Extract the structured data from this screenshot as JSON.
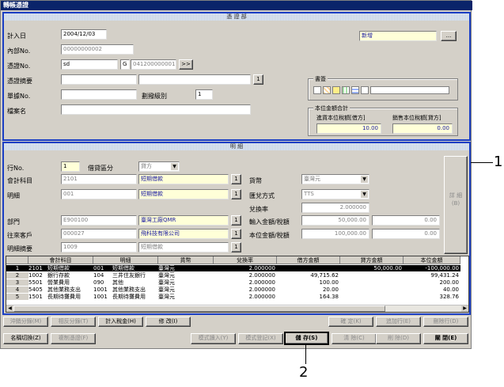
{
  "window": {
    "title": "轉帳憑證"
  },
  "header_panel": {
    "title": "憑 證 部",
    "entry_date_label": "計入日",
    "entry_date": "2004/12/03",
    "internal_no_label": "內部No.",
    "internal_no": "00000000002",
    "voucher_no_label": "憑證No.",
    "voucher_no": "sd",
    "voucher_type": "G",
    "voucher_seq": "041200000001",
    "voucher_btn": ">>",
    "summary_label": "憑證摘要",
    "summary_btn": "1",
    "doc_no_label": "單據No.",
    "revise_level_label": "劃撥級別",
    "revise_level": "1",
    "filename_label": "檔案名",
    "status": "新增",
    "status_btn": "...",
    "book_label": "書簽",
    "totals_label": "本位金額合計",
    "debit_total_label": "進貨本位稅額[借方]",
    "debit_total": "10.00",
    "credit_total_label": "銷售本位稅額[貸方]",
    "credit_total": "0.00"
  },
  "detail_panel": {
    "title": "明 細",
    "line_no_label": "行No.",
    "line_no": "1",
    "dc_label": "借貸區分",
    "dc_value": "貸方",
    "account_label": "會計科目",
    "account_code": "2101",
    "account_name": "短期借款",
    "detail_label": "明細",
    "detail_code": "001",
    "detail_name": "短期借款",
    "dept_label": "部門",
    "dept_code": "E900100",
    "dept_name": "臺灣工廠QMR",
    "partner_label": "往來客戶",
    "partner_code": "000027",
    "partner_name": "飛科技有限公司",
    "line_summary_label": "明細摘要",
    "line_summary_code": "1009",
    "line_summary_name": "短期借款",
    "currency_label": "貨幣",
    "currency": "臺灣元",
    "rate_method_label": "匯兌方式",
    "rate_method": "TTS",
    "rate_label": "兌換率",
    "rate": "2.000000",
    "input_amount_label": "輸入金額/稅額",
    "input_amount": "50,000.00",
    "input_tax": "0.00",
    "base_amount_label": "本位金額/稅額",
    "base_amount": "100,000.00",
    "base_tax": "0.00",
    "pick_btn": "1",
    "detail_btn": "詳 細",
    "detail_btn_key": "(B)"
  },
  "grid": {
    "columns": [
      "",
      "會計科目",
      "明細",
      "貨幣",
      "兌換率",
      "借方金額",
      "貸方金額",
      "本位金額"
    ],
    "rows": [
      {
        "no": "1",
        "acct": "2101",
        "acct_name": "短期借款",
        "det": "001",
        "det_name": "短期借款",
        "cur": "臺灣元",
        "rate": "2.000000",
        "debit": "",
        "credit": "50,000.00",
        "base": "-100,000.00"
      },
      {
        "no": "2",
        "acct": "1002",
        "acct_name": "銀行存款",
        "det": "104",
        "det_name": "三井住友銀行",
        "cur": "臺灣元",
        "rate": "2.000000",
        "debit": "49,715.62",
        "credit": "",
        "base": "99,431.24"
      },
      {
        "no": "3",
        "acct": "5501",
        "acct_name": "營業費用",
        "det": "090",
        "det_name": "其他",
        "cur": "臺灣元",
        "rate": "2.000000",
        "debit": "100.00",
        "credit": "",
        "base": "200.00"
      },
      {
        "no": "4",
        "acct": "5405",
        "acct_name": "其他業務支出",
        "det": "1001",
        "det_name": "其他業務支出",
        "cur": "臺灣元",
        "rate": "2.000000",
        "debit": "20.00",
        "credit": "",
        "base": "40.00"
      },
      {
        "no": "5",
        "acct": "1501",
        "acct_name": "長期待攤費用",
        "det": "1001",
        "det_name": "長期待攤費用",
        "cur": "臺灣元",
        "rate": "2.000000",
        "debit": "164.38",
        "credit": "",
        "base": "328.76"
      }
    ]
  },
  "buttons_row1": {
    "offset": "沖銷分錄(M)",
    "reverse": "相反分錄(T)",
    "calc_tax": "計入稅金(H)",
    "modify": "修 改(I)",
    "confirm": "確 定(K)",
    "add_line": "追加行(E)",
    "delete_line": "刪除行(D)"
  },
  "buttons_row2": {
    "switch": "名稱切換(Z)",
    "copy": "複制憑證(F)",
    "import": "模式讀入(Y)",
    "register": "模式登記(X)",
    "save": "儲 存(S)",
    "clear": "清 除(C)",
    "delete": "削 除(D)",
    "close": "關 閉(E)"
  },
  "callouts": {
    "c1": "1",
    "c2": "2"
  }
}
